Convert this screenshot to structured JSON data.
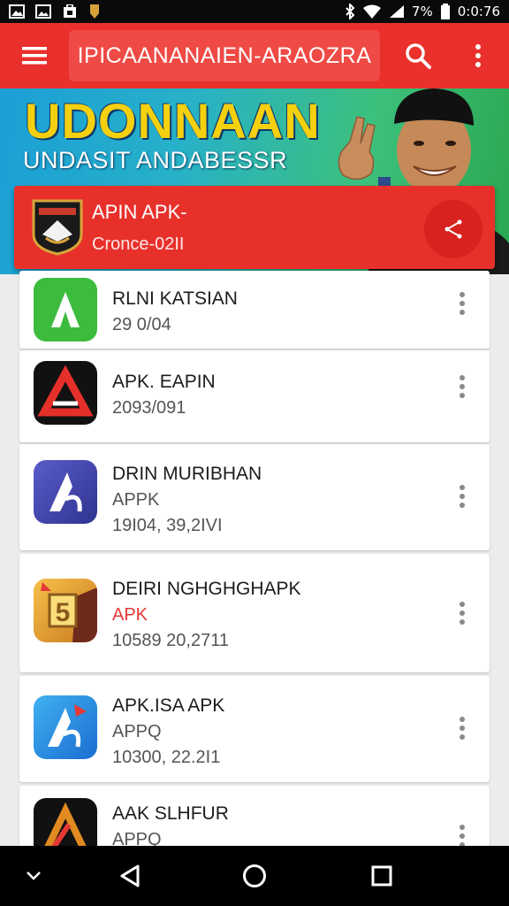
{
  "status_bar": {
    "battery_text": "7%",
    "time": "0:0:76"
  },
  "app_bar": {
    "title": "IPICAANANAIEN-ARAOZRA"
  },
  "banner": {
    "title": "UDONNAAN",
    "subtitle": "UNDASIT ANDABESSR"
  },
  "featured": {
    "name": "APIN APK-",
    "date": "Cronce-02II"
  },
  "apps": [
    {
      "title": "RLNI KATSIAN",
      "line1": "",
      "line2": "29 0/04"
    },
    {
      "title": "APK. EAPIN",
      "line1": "",
      "line2": "2093/091"
    },
    {
      "title": "DRIN MURIBHAN",
      "line1": "APPK",
      "line2": "19I04, 39,2IVI"
    },
    {
      "title": "DEIRI NGHGHGHAPK",
      "line1": "APK",
      "line2": "10589 20,2711"
    },
    {
      "title": "APK.ISA APK",
      "line1": "APPQ",
      "line2": "10300, 22.2I1"
    },
    {
      "title": "AAK SLHFUR",
      "line1": "APPQ",
      "line2": ""
    }
  ],
  "colors": {
    "primary": "#e9302d",
    "primary_dark": "#d8221f",
    "banner_yellow": "#f4d00e"
  },
  "icons": [
    "menu-icon",
    "search-icon",
    "more-vert-icon",
    "share-icon",
    "back-icon",
    "home-icon",
    "recents-icon",
    "chevron-down-icon"
  ]
}
